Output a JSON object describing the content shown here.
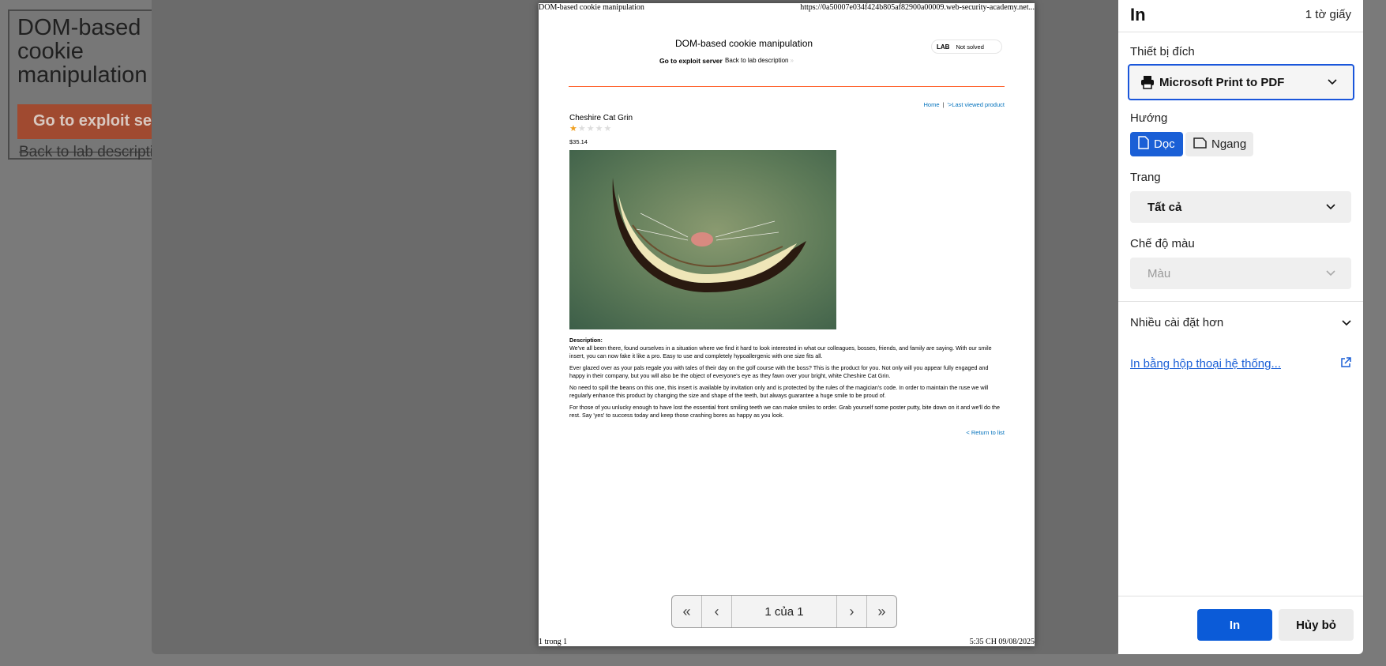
{
  "background_page": {
    "title": "DOM-based cookie manipulation",
    "exploit_button": "Go to exploit server",
    "back_link": "Back to lab description"
  },
  "preview": {
    "header_left": "DOM-based cookie manipulation",
    "header_right": "https://0a50007e034f424b805af82900a00009.web-security-academy.net...",
    "footer_left": "1 trong 1",
    "footer_right": "5:35 CH 09/08/2025",
    "lab": {
      "title": "DOM-based cookie manipulation",
      "exploit_link": "Go to exploit server",
      "back_link": "Back to lab description",
      "badge_label": "LAB",
      "badge_status": "Not solved"
    },
    "nav": {
      "home": "Home",
      "separator": "|",
      "last_viewed": "'>Last viewed product"
    },
    "product": {
      "name": "Cheshire Cat Grin",
      "rating_stars": 1,
      "rating_max": 5,
      "price": "$35.14",
      "description_label": "Description:",
      "paragraphs": [
        "We've all been there, found ourselves in a situation where we find it hard to look interested in what our colleagues, bosses, friends, and family are saying. With our smile insert, you can now fake it like a pro. Easy to use and completely hypoallergenic with one size fits all.",
        "Ever glazed over as your pals regale you with tales of their day on the golf course with the boss? This is the product for you. Not only will you appear fully engaged and happy in their company, but you will also be the object of everyone's eye as they fawn over your bright, white Cheshire Cat Grin.",
        "No need to spill the beans on this one, this insert is available by invitation only and is protected by the rules of the magician's code. In order to maintain the ruse we will regularly enhance this product by changing the size and shape of the teeth, but always guarantee a huge smile to be proud of.",
        "For those of you unlucky enough to have lost the essential front smiling teeth we can make smiles to order. Grab yourself some poster putty, bite down on it and we'll do the rest. Say 'yes' to success today and keep those crashing bores as happy as you look."
      ],
      "return_link": "< Return to list"
    },
    "pager": {
      "info": "1 của 1"
    }
  },
  "panel": {
    "title": "In",
    "sheet_count": "1 tờ giấy",
    "destination_label": "Thiết bị đích",
    "destination_value": "Microsoft Print to PDF",
    "orientation_label": "Hướng",
    "orientation_portrait": "Dọc",
    "orientation_landscape": "Ngang",
    "pages_label": "Trang",
    "pages_value": "Tất cả",
    "color_label": "Chế độ màu",
    "color_value": "Màu",
    "more_settings": "Nhiều cài đặt hơn",
    "system_dialog_link": "In bằng hộp thoại hệ thống...",
    "print_button": "In",
    "cancel_button": "Hủy bỏ"
  },
  "colors": {
    "accent_blue": "#0b5bd8",
    "lab_orange": "#ff6633",
    "link_blue": "#0071bc",
    "star_gold": "#f0a020"
  }
}
